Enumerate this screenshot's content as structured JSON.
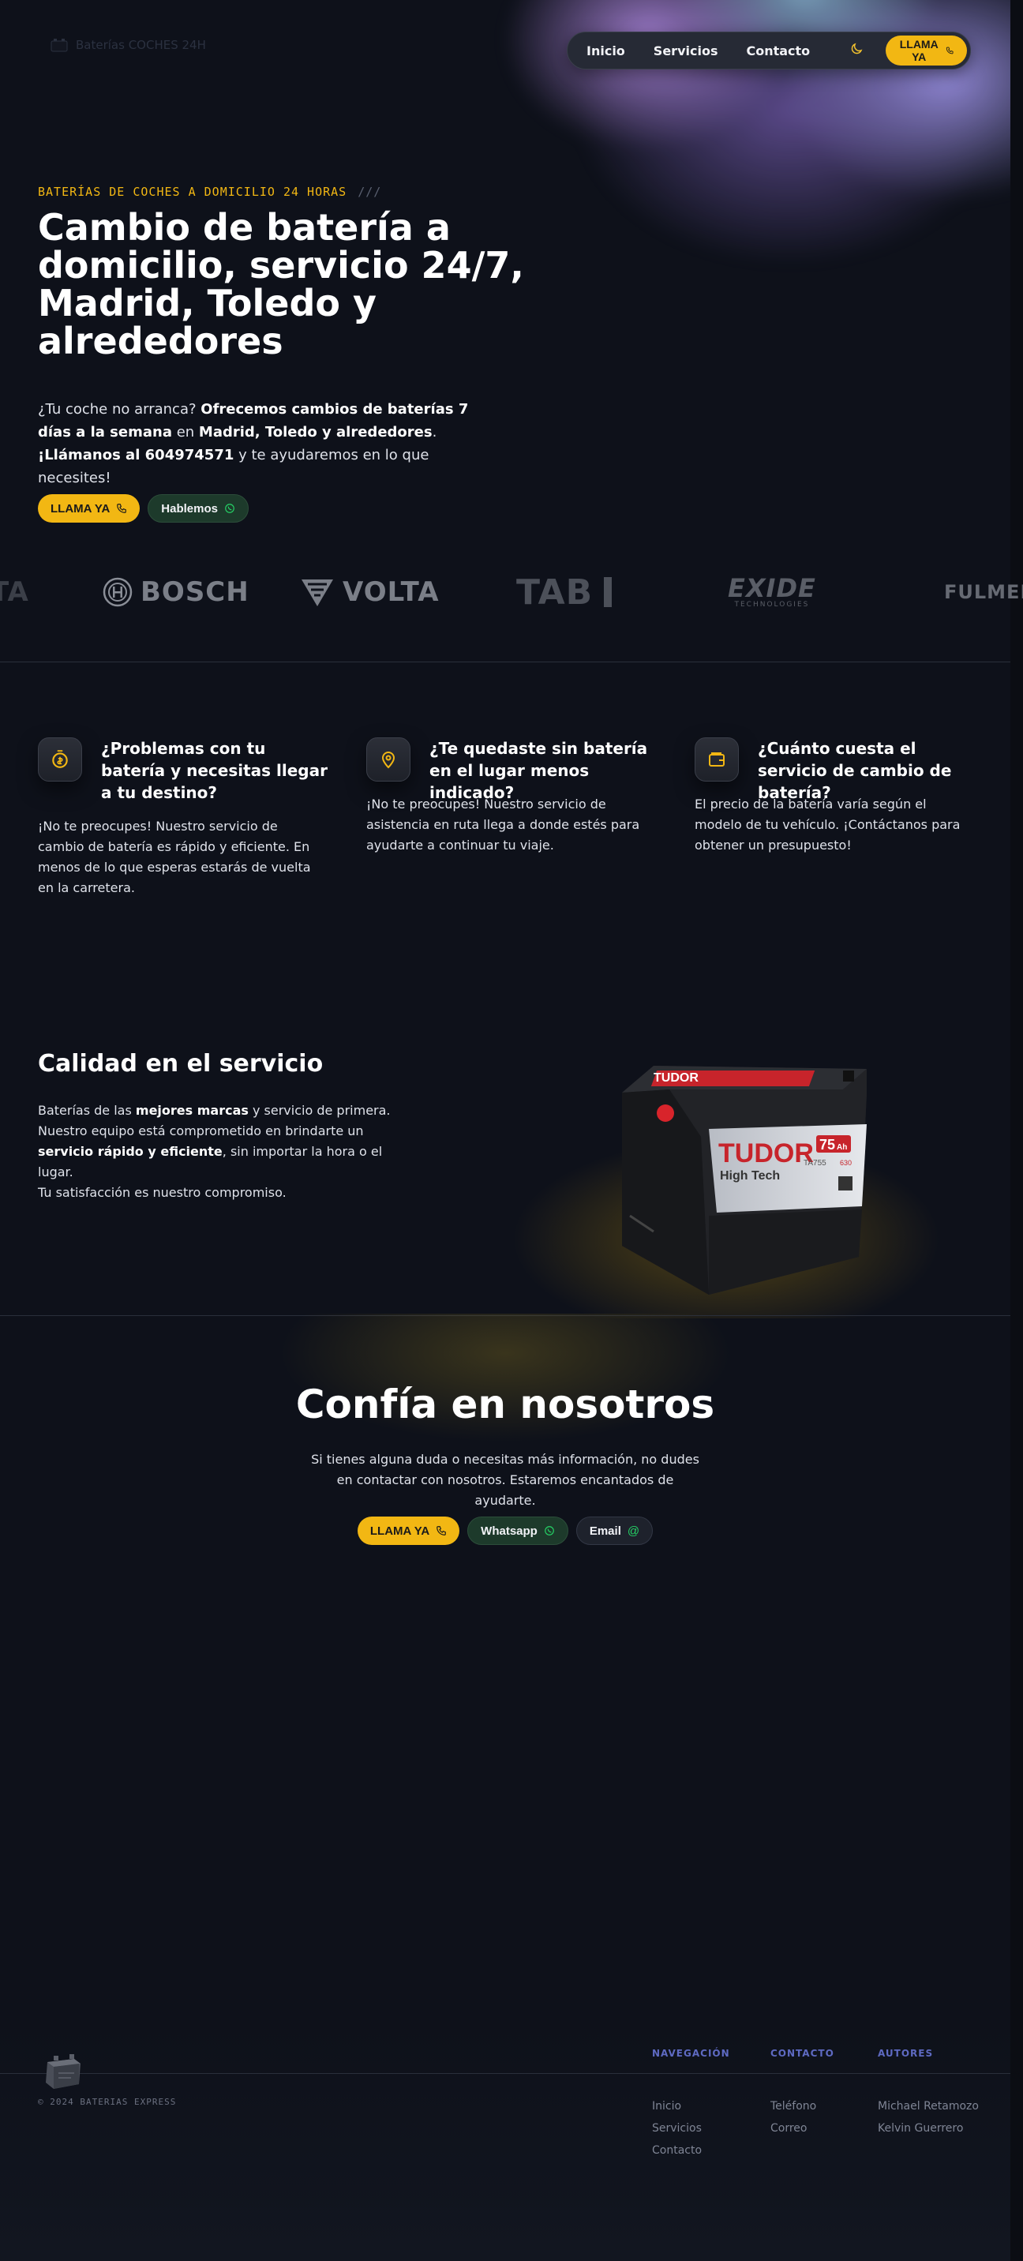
{
  "colors": {
    "accent": "#f2b713",
    "whatsapp": "#25d366",
    "footer_heading": "#5e6ac2"
  },
  "logo": {
    "text": "Baterías COCHES 24H",
    "icon": "battery-icon"
  },
  "nav": {
    "items": [
      "Inicio",
      "Servicios",
      "Contacto"
    ],
    "theme_icon": "moon-icon",
    "cta": "LLAMA YA",
    "cta_icon": "phone-icon"
  },
  "hero": {
    "eyebrow": "BATERÍAS DE COCHES A DOMICILIO 24 HORAS",
    "eyebrow_deco": "///",
    "title": "Cambio de batería a domicilio, servicio 24/7, Madrid, Toledo y alrededores",
    "text": {
      "p1": "¿Tu coche no arranca? ",
      "b1": "Ofrecemos cambios de baterías 7 días a la semana",
      "p2": " en ",
      "b2": "Madrid, Toledo y alrededores",
      "p3": ". ",
      "b3": "¡Llámanos al 604974571",
      "p4": " y te ayudaremos en lo que necesites!"
    },
    "btn_call": "LLAMA YA",
    "btn_talk": "Hablemos"
  },
  "brands": [
    "TA",
    "BOSCH",
    "VOLTA",
    "TAB",
    "EXIDE",
    "FULMEN"
  ],
  "brands_sub": {
    "exide": "TECHNOLOGIES"
  },
  "features": [
    {
      "title": "¿Problemas con tu batería y necesitas llegar a tu destino?",
      "text": "¡No te preocupes! Nuestro servicio de cambio de batería es rápido y eficiente. En menos de lo que esperas estarás de vuelta en la carretera.",
      "icon": "stopwatch-dollar-icon"
    },
    {
      "title": "¿Te quedaste sin batería en el lugar menos indicado?",
      "text": "¡No te preocupes! Nuestro servicio de asistencia en ruta llega a donde estés para ayudarte a continuar tu viaje.",
      "icon": "map-pin-icon"
    },
    {
      "title": "¿Cuánto cuesta el servicio de cambio de batería?",
      "text": "El precio de la batería varía según el modelo de tu vehículo. ¡Contáctanos para obtener un presupuesto!",
      "icon": "wallet-icon"
    }
  ],
  "quality": {
    "title": "Calidad en el servicio",
    "t1": "Baterías de las ",
    "b1": "mejores marcas",
    "t2": " y servicio de primera. Nuestro equipo está comprometido en brindarte un ",
    "b2": "servicio rápido y eficiente",
    "t3": ", sin importar la hora o el lugar.",
    "t4": "Tu satisfacción es nuestro compromiso.",
    "battery": {
      "brand": "TUDOR",
      "line": "High Tech",
      "capacity": "75",
      "unit": "Ah",
      "model": "TA755",
      "amps": "630"
    }
  },
  "trust": {
    "title": "Confía en nosotros",
    "text": "Si tienes alguna duda o necesitas más información, no dudes en contactar con nosotros. Estaremos encantados de ayudarte.",
    "btn_call": "LLAMA YA",
    "btn_whatsapp": "Whatsapp",
    "btn_email": "Email"
  },
  "footer": {
    "copyright": "© 2024 BATERIAS EXPRESS",
    "columns": [
      {
        "heading": "NAVEGACIÓN",
        "links": [
          "Inicio",
          "Servicios",
          "Contacto"
        ]
      },
      {
        "heading": "CONTACTO",
        "links": [
          "Teléfono",
          "Correo"
        ]
      },
      {
        "heading": "AUTORES",
        "links": [
          "Michael Retamozo",
          "Kelvin Guerrero"
        ]
      }
    ]
  }
}
